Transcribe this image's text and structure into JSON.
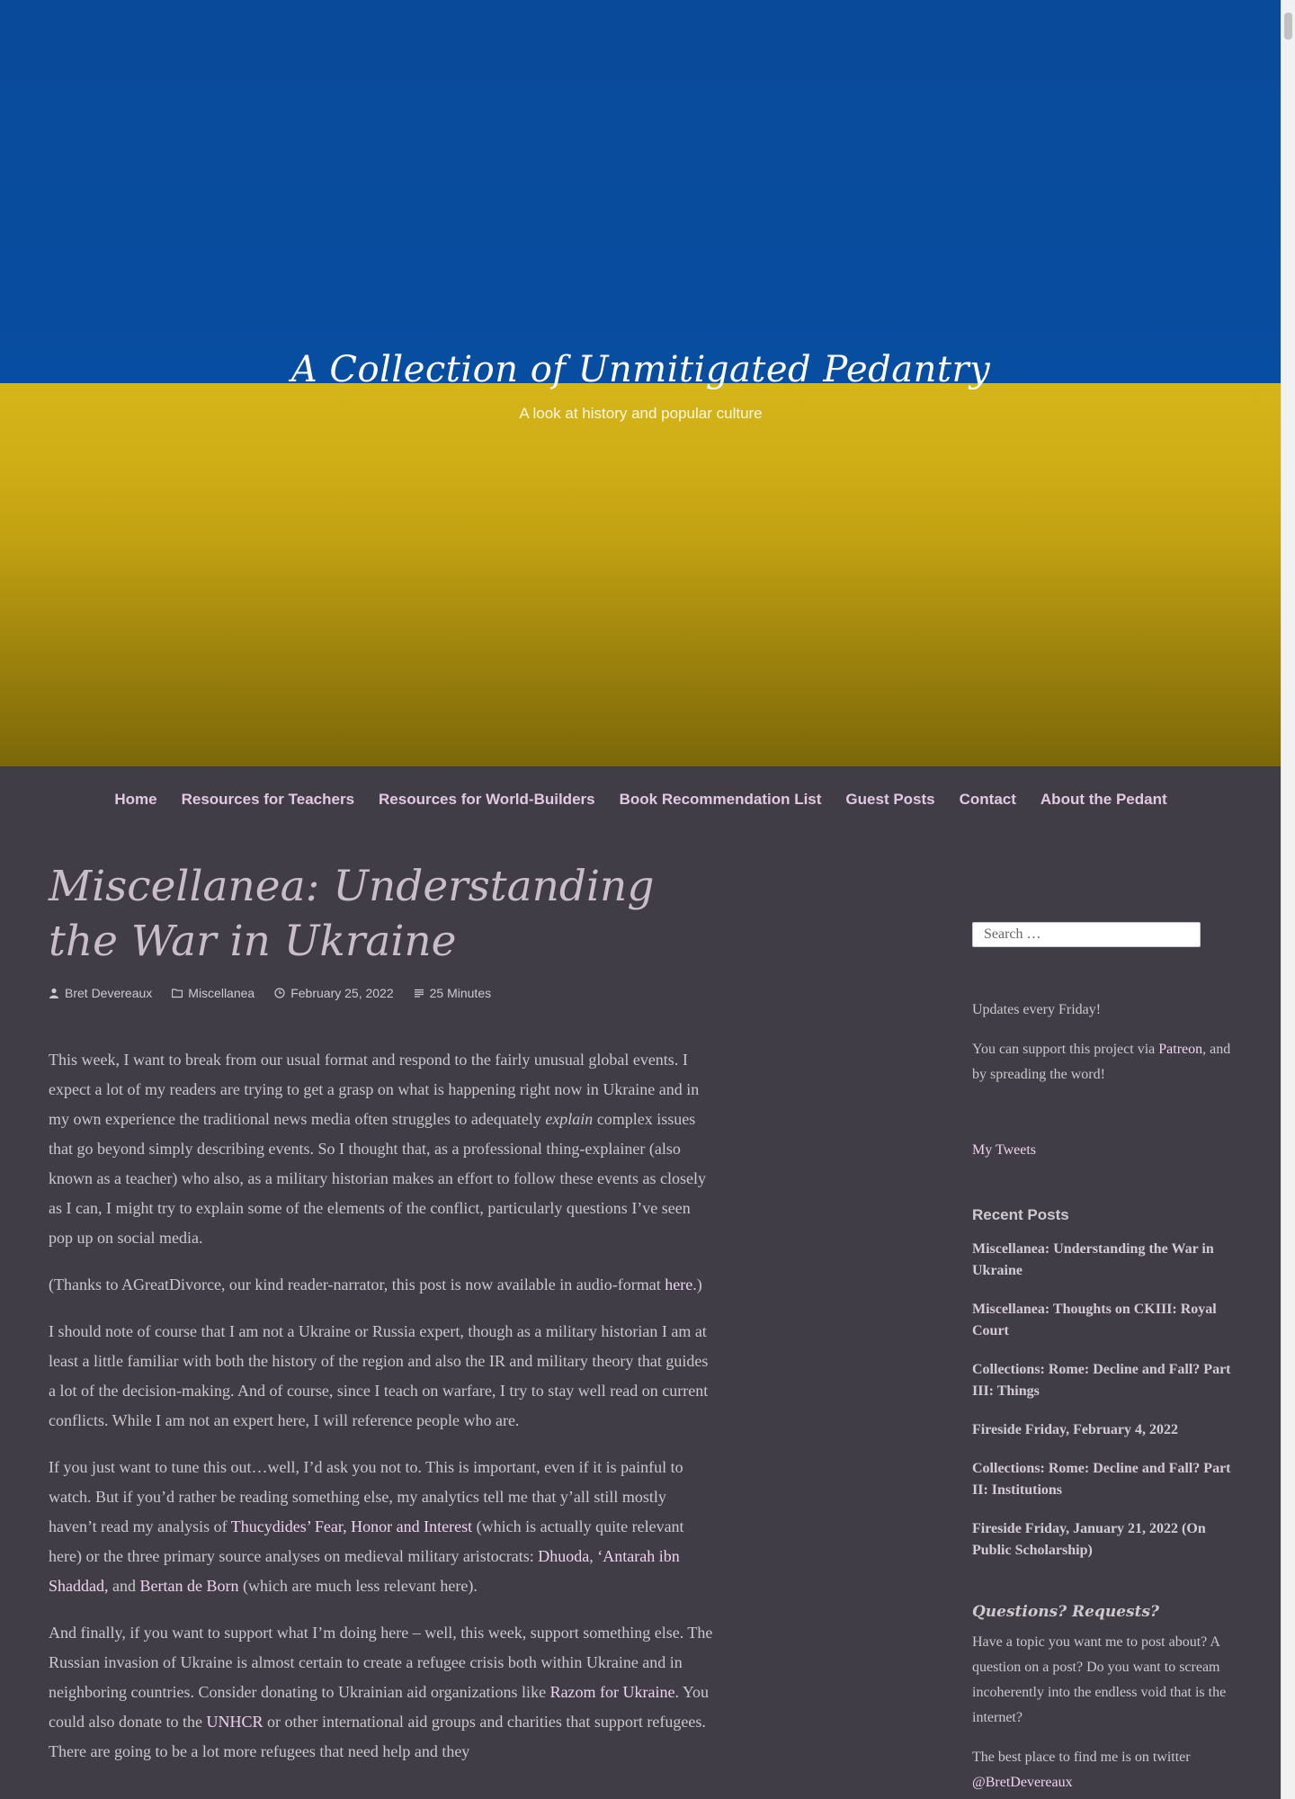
{
  "site": {
    "title": "A Collection of Unmitigated Pedantry",
    "tagline": "A look at history and popular culture"
  },
  "nav": {
    "items": [
      "Home",
      "Resources for Teachers",
      "Resources for World-Builders",
      "Book Recommendation List",
      "Guest Posts",
      "Contact",
      "About the Pedant"
    ]
  },
  "post": {
    "title": "Miscellanea: Understanding the War in Ukraine",
    "author": "Bret Devereaux",
    "category": "Miscellanea",
    "date": "February 25, 2022",
    "reading_time": "25 Minutes",
    "p1_a": "This week, I want to break from our usual format and respond to the fairly unusual global events. I expect a lot of my readers are trying to get a grasp on what is happening right now in Ukraine and in my own experience the traditional news media often struggles to adequately ",
    "p1_em": "explain",
    "p1_b": " complex issues that go beyond simply describing events. So I thought that, as a professional thing-explainer (also known as a teacher) who also, as a military historian makes an effort to follow these events as closely as I can, I might try to explain some of the elements of the conflict, particularly questions I’ve seen pop up on social media.",
    "p2_a": "(Thanks to AGreatDivorce, our kind reader-narrator, this post is now available in audio-format ",
    "p2_link": "here",
    "p2_b": ".)",
    "p3": "I should note of course that I am not a Ukraine or Russia expert, though as a military historian I am at least a little familiar with both the history of the region and also the IR and military theory that guides a lot of the decision-making. And of course, since I teach on warfare, I try to stay well read on current conflicts. While I am not an expert here, I will reference people who are.",
    "p4_a": "If you just want to tune this out…well, I’d ask you not to. This is important, even if it is painful to watch. But if you’d rather be reading something else, my analytics tell me that y’all still mostly haven’t read my analysis of ",
    "p4_link1": "Thucydides’ Fear, Honor and Interest",
    "p4_b": " (which is actually quite relevant here) or the three primary source analyses on medieval military aristocrats: ",
    "p4_link2": "Dhuoda",
    "p4_c": ", ",
    "p4_link3": "‘Antarah ibn Shaddad,",
    "p4_d": " and ",
    "p4_link4": "Bertan de Born",
    "p4_e": " (which are much less relevant here).",
    "p5_a": "And finally, if you want to support what I’m doing here – well, this week, support something else. The Russian invasion of Ukraine is almost certain to create a refugee crisis both within Ukraine and in neighboring countries. Consider donating to Ukrainian aid organizations like ",
    "p5_link1": "Razom for Ukraine",
    "p5_b": ". You could also donate to the ",
    "p5_link2": "UNHCR",
    "p5_c": " or other international aid groups and charities that support refugees. There are going to be a lot more refugees that need help and they"
  },
  "sidebar": {
    "search_placeholder": "Search …",
    "updates": "Updates every Friday!",
    "support_a": "You can support this project via ",
    "support_link": "Patreon",
    "support_b": ", and by spreading the word!",
    "tweets_link": "My Tweets",
    "recent_title": "Recent Posts",
    "recent_posts": [
      "Miscellanea: Understanding the War in Ukraine",
      "Miscellanea: Thoughts on CKIII: Royal Court",
      "Collections: Rome: Decline and Fall? Part III: Things",
      "Fireside Friday, February 4, 2022",
      "Collections: Rome: Decline and Fall? Part II: Institutions",
      "Fireside Friday, January 21, 2022 (On Public Scholarship)"
    ],
    "questions_title": "Questions? Requests?",
    "questions_text": "Have a topic you want me to post about?  A question on a post?  Do you want to scream incoherently into the endless void that is the internet?",
    "twitter_text": "The best place to find me is on twitter",
    "twitter_handle": "@BretDevereaux"
  },
  "colors": {
    "background": "#403d47",
    "banner_blue": "#074da1",
    "banner_yellow": "#d6b51a",
    "link": "#f0d2f0"
  },
  "icons": [
    "person-icon",
    "folder-icon",
    "clock-icon",
    "list-icon"
  ]
}
